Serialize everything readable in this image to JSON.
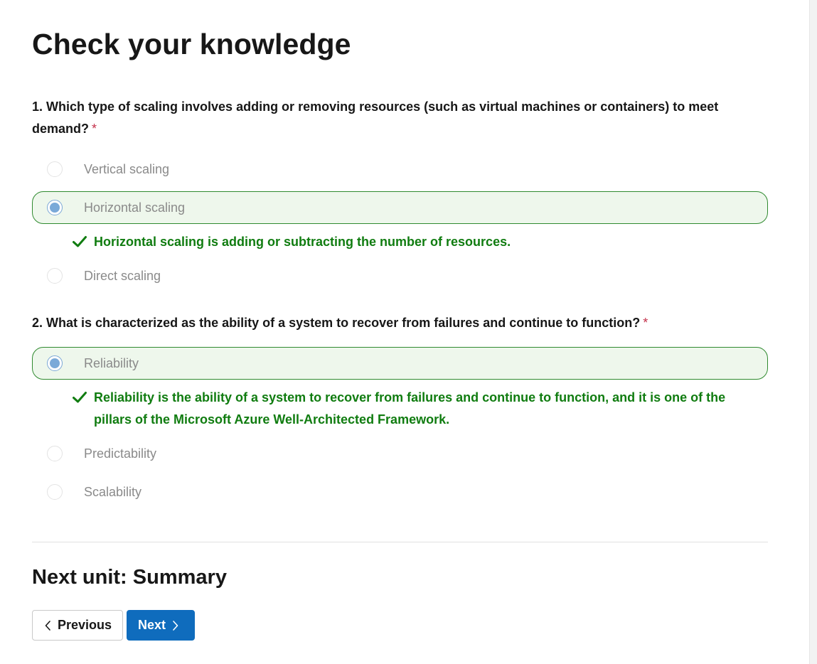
{
  "page": {
    "title": "Check your knowledge"
  },
  "questions": [
    {
      "text": "1. Which type of scaling involves adding or removing resources (such as virtual machines or containers) to meet demand?",
      "required_mark": "*",
      "options": [
        {
          "label": "Vertical scaling",
          "selected": false
        },
        {
          "label": "Horizontal scaling",
          "selected": true
        },
        {
          "label": "Direct scaling",
          "selected": false
        }
      ],
      "feedback": "Horizontal scaling is adding or subtracting the number of resources."
    },
    {
      "text": "2. What is characterized as the ability of a system to recover from failures and continue to function?",
      "required_mark": "*",
      "options": [
        {
          "label": "Reliability",
          "selected": true
        },
        {
          "label": "Predictability",
          "selected": false
        },
        {
          "label": "Scalability",
          "selected": false
        }
      ],
      "feedback": "Reliability is the ability of a system to recover from failures and continue to function, and it is one of the pillars of the Microsoft Azure Well-Architected Framework."
    }
  ],
  "next_unit": {
    "heading": "Next unit: Summary"
  },
  "navigation": {
    "previous_label": "Previous",
    "next_label": "Next"
  },
  "colors": {
    "correct_green": "#107c10",
    "selected_background": "#eef7ec",
    "primary_blue": "#0f6cbd",
    "required_red": "#c4314b"
  },
  "icons": {
    "feedback": "checkmark-icon",
    "previous": "chevron-left-icon",
    "next": "chevron-right-icon"
  }
}
